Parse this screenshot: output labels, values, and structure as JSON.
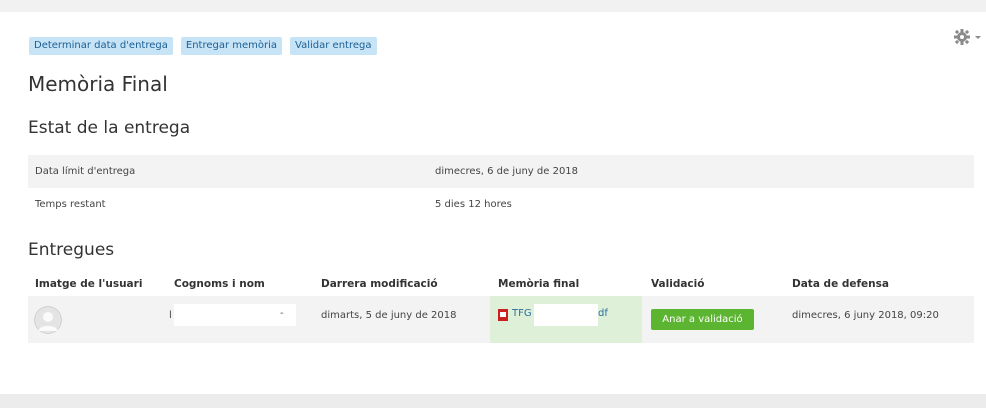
{
  "actions": [
    "Determinar data d'entrega",
    "Entregar memòria",
    "Validar entrega"
  ],
  "page_title": "Memòria Final",
  "status": {
    "heading": "Estat de la entrega",
    "rows": [
      {
        "label": "Data límit d'entrega",
        "value": "dimecres, 6 de juny de 2018"
      },
      {
        "label": "Temps restant",
        "value": "5 dies 12 hores"
      }
    ]
  },
  "submissions": {
    "heading": "Entregues",
    "columns": [
      "Imatge de l'usuari",
      "Cognoms i nom",
      "Darrera modificació",
      "Memòria final",
      "Validació",
      "Data de defensa"
    ],
    "row": {
      "name_prefix": "l",
      "name_suffix": "-",
      "last_modified": "dimarts, 5 de juny de 2018",
      "file_prefix": "TFG",
      "file_suffix": "df",
      "validate_button": "Anar a validació",
      "defense_date": "dimecres, 6 juny 2018, 09:20"
    }
  },
  "icons": {
    "settings": "gear-icon",
    "avatar": "user-avatar-icon",
    "file": "pdf-icon"
  },
  "colors": {
    "pill_bg": "#c7e3f6",
    "pill_text": "#1c5f94",
    "success_bg": "#dff0d8",
    "button_green": "#5cb531",
    "link": "#2a6ea3"
  }
}
